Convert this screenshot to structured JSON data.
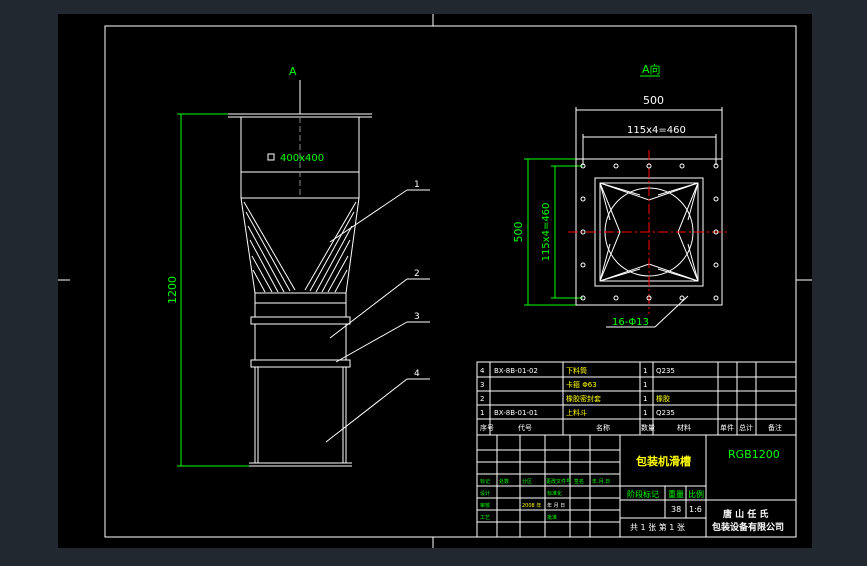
{
  "colors": {
    "background": "#212830",
    "paper": "#000000",
    "border": "#ffffff",
    "line": "#ffffff",
    "dimension": "#00ff00",
    "leader": "#ffffff",
    "title_text": "#ffffff",
    "accent_text": "#ffff00",
    "centerline": "#ff0000"
  },
  "front_view": {
    "view_label": "A",
    "opening_label": "400x400",
    "height_dim": "1200",
    "balloons": [
      "1",
      "2",
      "3",
      "4"
    ]
  },
  "top_view": {
    "title": "A向",
    "width_dim": "500",
    "pitch_h": "115x4=460",
    "height_dim": "500",
    "pitch_v": "115x4=460",
    "holes_label": "16-Φ13"
  },
  "bom": {
    "rows": [
      {
        "no": "4",
        "code": "BX-8B-01-02",
        "name": "下料筒",
        "qty": "1",
        "material": "Q235",
        "remark": ""
      },
      {
        "no": "3",
        "code": "",
        "name": "卡箍 Φ63",
        "qty": "1",
        "material": "",
        "remark": ""
      },
      {
        "no": "2",
        "code": "",
        "name": "橡胶密封套",
        "qty": "1",
        "material": "橡胶",
        "remark": ""
      },
      {
        "no": "1",
        "code": "BX-8B-01-01",
        "name": "上料斗",
        "qty": "1",
        "material": "Q235",
        "remark": ""
      }
    ],
    "header": {
      "no": "序号",
      "code": "代号",
      "name": "名称",
      "qty": "数量",
      "material": "材料",
      "unit_weight": "单件",
      "total_weight": "总计",
      "remark": "备注"
    }
  },
  "title_block": {
    "part_name": "包装机滑槽",
    "drawing_no": "RGB1200",
    "stage_label": "阶段标记",
    "weight_label": "重量",
    "scale_label": "比例",
    "weight": "38",
    "scale": "1:6",
    "sheets": "共 1 张  第 1 张",
    "company_line1": "唐 山 任 氏",
    "company_line2": "包装设备有限公司",
    "date": "2008 年",
    "date2": "年 月 日",
    "small_labels": [
      "标记",
      "处数",
      "分区",
      "更改文件号",
      "签名",
      "年.月.日",
      "设计",
      "标准化",
      "审核",
      "工艺",
      "批准"
    ]
  }
}
